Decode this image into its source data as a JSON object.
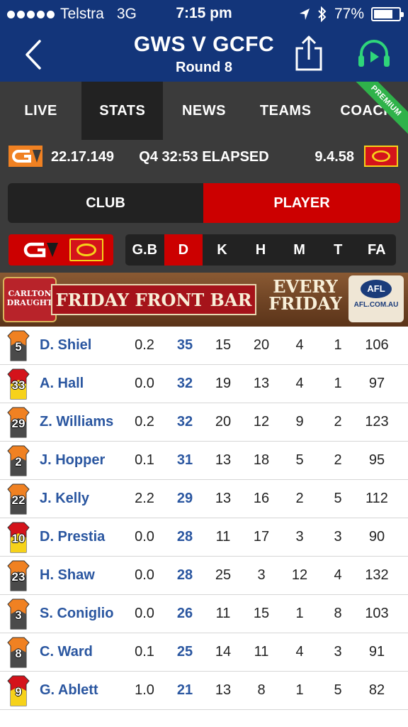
{
  "status_bar": {
    "carrier": "Telstra",
    "network": "3G",
    "time": "7:15 pm",
    "battery_percent": "77%",
    "battery_level": 0.77
  },
  "header": {
    "title": "GWS V GCFC",
    "subtitle": "Round 8",
    "icons": [
      "back-chevron-icon",
      "share-icon",
      "audio-play-icon"
    ]
  },
  "tabs": [
    {
      "label": "LIVE",
      "active": false
    },
    {
      "label": "STATS",
      "active": true
    },
    {
      "label": "NEWS",
      "active": false
    },
    {
      "label": "TEAMS",
      "active": false
    },
    {
      "label": "COACH",
      "active": false
    }
  ],
  "premium_badge": "PREMIUM",
  "scoreboard": {
    "home_score": "22.17.149",
    "status": "Q4 32:53 ELAPSED",
    "away_score": "9.4.58"
  },
  "segment": {
    "club": "CLUB",
    "player": "PLAYER",
    "selected": "player"
  },
  "stat_tabs": [
    {
      "label": "G.B",
      "active": false
    },
    {
      "label": "D",
      "active": true
    },
    {
      "label": "K",
      "active": false
    },
    {
      "label": "H",
      "active": false
    },
    {
      "label": "M",
      "active": false
    },
    {
      "label": "T",
      "active": false
    },
    {
      "label": "FA",
      "active": false
    }
  ],
  "ad": {
    "brand": "CARLTON DRAUGHT",
    "headline": "FRIDAY FRONT BAR",
    "tagline_1": "EVERY",
    "tagline_2": "FRIDAY",
    "afl_logo": "AFL",
    "afl_site": "AFL.COM.AU"
  },
  "colors": {
    "navy": "#13357a",
    "dark_grey": "#3b3b3b",
    "tab_active": "#222222",
    "red": "#cc0000",
    "gws_orange": "#f08122",
    "link_blue": "#2a56a0",
    "audio_green": "#2fd57a"
  },
  "players": [
    {
      "number": "5",
      "name": "D. Shiel",
      "gb": "0.2",
      "d": "35",
      "k": "15",
      "h": "20",
      "m": "4",
      "t": "1",
      "fa": "106",
      "team": "gws"
    },
    {
      "number": "33",
      "name": "A. Hall",
      "gb": "0.0",
      "d": "32",
      "k": "19",
      "h": "13",
      "m": "4",
      "t": "1",
      "fa": "97",
      "team": "gc"
    },
    {
      "number": "29",
      "name": "Z. Williams",
      "gb": "0.2",
      "d": "32",
      "k": "20",
      "h": "12",
      "m": "9",
      "t": "2",
      "fa": "123",
      "team": "gws"
    },
    {
      "number": "2",
      "name": "J. Hopper",
      "gb": "0.1",
      "d": "31",
      "k": "13",
      "h": "18",
      "m": "5",
      "t": "2",
      "fa": "95",
      "team": "gws"
    },
    {
      "number": "22",
      "name": "J. Kelly",
      "gb": "2.2",
      "d": "29",
      "k": "13",
      "h": "16",
      "m": "2",
      "t": "5",
      "fa": "112",
      "team": "gws"
    },
    {
      "number": "10",
      "name": "D. Prestia",
      "gb": "0.0",
      "d": "28",
      "k": "11",
      "h": "17",
      "m": "3",
      "t": "3",
      "fa": "90",
      "team": "gc"
    },
    {
      "number": "23",
      "name": "H. Shaw",
      "gb": "0.0",
      "d": "28",
      "k": "25",
      "h": "3",
      "m": "12",
      "t": "4",
      "fa": "132",
      "team": "gws"
    },
    {
      "number": "3",
      "name": "S. Coniglio",
      "gb": "0.0",
      "d": "26",
      "k": "11",
      "h": "15",
      "m": "1",
      "t": "8",
      "fa": "103",
      "team": "gws"
    },
    {
      "number": "8",
      "name": "C. Ward",
      "gb": "0.1",
      "d": "25",
      "k": "14",
      "h": "11",
      "m": "4",
      "t": "3",
      "fa": "91",
      "team": "gws"
    },
    {
      "number": "9",
      "name": "G. Ablett",
      "gb": "1.0",
      "d": "21",
      "k": "13",
      "h": "8",
      "m": "1",
      "t": "5",
      "fa": "82",
      "team": "gc"
    }
  ]
}
